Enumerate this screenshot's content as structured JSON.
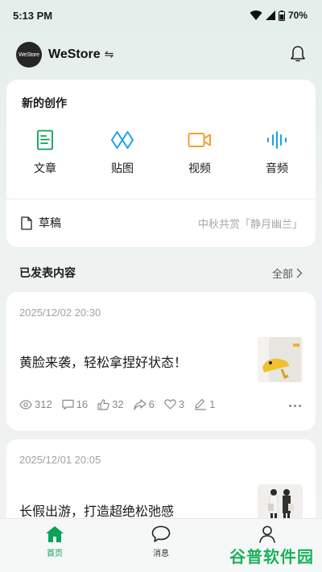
{
  "status_bar": {
    "time": "5:13 PM",
    "battery": "70%"
  },
  "header": {
    "avatar_text": "WeStore",
    "store_name": "WeStore",
    "switch_symbol": "⇋"
  },
  "create": {
    "title": "新的创作",
    "items": [
      {
        "label": "文章",
        "icon": "document-icon",
        "color": "#07a35a"
      },
      {
        "label": "贴图",
        "icon": "sticker-icon",
        "color": "#1aa3dc"
      },
      {
        "label": "视频",
        "icon": "video-icon",
        "color": "#f0a02f"
      },
      {
        "label": "音频",
        "icon": "audio-icon",
        "color": "#1aa3dc"
      }
    ],
    "draft_label": "草稿",
    "draft_hint": "中秋共赏「静月幽兰」"
  },
  "published": {
    "title": "已发表内容",
    "all_label": "全部"
  },
  "posts": [
    {
      "date": "2025/12/02 20:30",
      "title": "黄脸来袭，轻松拿捏好状态！",
      "stats": {
        "views": "312",
        "comments": "16",
        "likes": "32",
        "shares": "6",
        "favorites": "3",
        "edits": "1"
      }
    },
    {
      "date": "2025/12/01 20:05",
      "title": "长假出游，打造超绝松弛感"
    }
  ],
  "tabs": [
    {
      "label": "首页",
      "active": true
    },
    {
      "label": "消息",
      "active": false
    }
  ],
  "watermark": "谷普软件园",
  "colors": {
    "accent": "#07a35a",
    "card": "#ffffff"
  }
}
